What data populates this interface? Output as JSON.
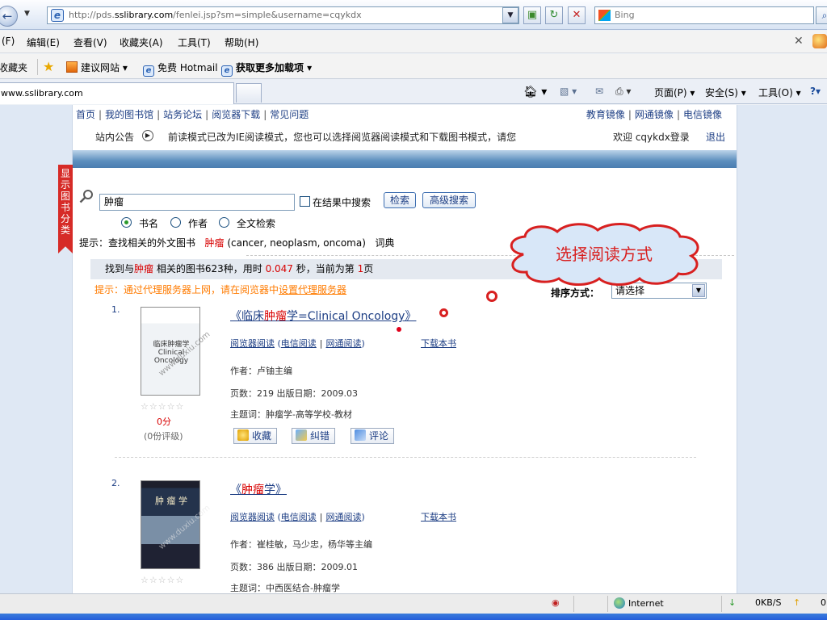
{
  "browser": {
    "url_prefix": "http://pds.",
    "url_domain": "sslibrary.com",
    "url_path": "/fenlei.jsp?sm=simple&username=cqykdx",
    "search_placeholder": "Bing",
    "menu": [
      "(F)",
      "编辑(E)",
      "查看(V)",
      "收藏夹(A)",
      "工具(T)",
      "帮助(H)"
    ],
    "favorites_label": "收藏夹",
    "favorites": [
      "建议网站 ▾",
      "免费 Hotmail",
      "获取更多加载项 ▾"
    ],
    "tab_title": "www.sslibrary.com",
    "commands": [
      "页面(P) ▾",
      "安全(S) ▾",
      "工具(O) ▾"
    ]
  },
  "site": {
    "top_links": [
      "首页",
      "我的图书馆",
      "站务论坛",
      "阅览器下载",
      "常见问题"
    ],
    "mirrors": [
      "教育镜像",
      "网通镜像",
      "电信镜像"
    ],
    "notice_label": "站内公告",
    "notice_text": "前读模式已改为IE阅读模式，您也可以选择阅览器阅读模式和下载图书模式，请您",
    "welcome": "欢迎 cqykdx登录",
    "logout": "退出",
    "side_tab": "显示图书分类"
  },
  "search": {
    "query": "肿瘤",
    "within_label": "在结果中搜索",
    "search_btn": "检索",
    "advanced_btn": "高级搜索",
    "options": [
      "书名",
      "作者",
      "全文检索"
    ],
    "hint_prefix": "提示：查找相关的外文图书",
    "hint_term": "肿瘤",
    "hint_terms_en": "(cancer, neoplasm, oncoma)",
    "hint_dict": "词典"
  },
  "results": {
    "summary_a": "找到与",
    "summary_term": "肿瘤",
    "summary_b": " 相关的图书623种，用时 ",
    "summary_time": "0.047",
    "summary_c": " 秒，当前为第 ",
    "summary_page": "1",
    "summary_d": "页",
    "proxy_tip": "提示：通过代理服务器上网，请在阅览器中",
    "proxy_link": "设置代理服务器",
    "sort_label": "排序方式：",
    "sort_value": "请选择"
  },
  "callout": {
    "text": "选择阅读方式"
  },
  "books": [
    {
      "num": "1.",
      "title_pre": "《临床",
      "title_term": "肿瘤",
      "title_post": "学=Clinical Oncology》",
      "read_viewer": "阅览器阅读",
      "read_telecom": "电信阅读",
      "read_netcom": "网通阅读",
      "download": "下载本书",
      "author": "作者：卢铀主编",
      "pages_date": "页数：219    出版日期：2009.03",
      "subject": "主题词：肿瘤学-高等学校-教材",
      "stars": "☆☆☆☆☆",
      "score": "0分",
      "score_count": "(0份评级)",
      "cover_title": "临床肿瘤学 Clinical Oncology",
      "actions": [
        "收藏",
        "纠错",
        "评论"
      ]
    },
    {
      "num": "2.",
      "title_pre": "《",
      "title_term": "肿瘤",
      "title_post": "学》",
      "read_viewer": "阅览器阅读",
      "read_telecom": "电信阅读",
      "read_netcom": "网通阅读",
      "download": "下载本书",
      "author": "作者：崔桂敏，马少忠，杨华等主编",
      "pages_date": "页数：386    出版日期：2009.01",
      "subject": "主题词：中西医结合-肿瘤学",
      "stars": "☆☆☆☆☆",
      "cover_title": "肿 瘤 学"
    }
  ],
  "watermark": "www.duxiu.com",
  "status": {
    "zone": "Internet",
    "speed_down": "0KB/S",
    "speed_up": "0"
  },
  "colors": {
    "link": "#1d3e84",
    "highlight": "#d80000",
    "tip": "#ff7b00",
    "callout": "#d82020"
  }
}
